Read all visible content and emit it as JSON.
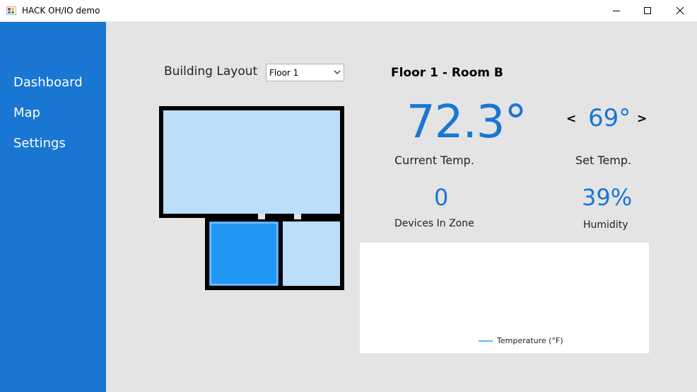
{
  "window": {
    "title": "HACK OH/IO demo",
    "controls": [
      "minimize",
      "maximize",
      "close"
    ]
  },
  "sidebar": {
    "background": "#1976d2",
    "items": [
      {
        "label": "Dashboard"
      },
      {
        "label": "Map"
      },
      {
        "label": "Settings"
      }
    ]
  },
  "layout": {
    "label": "Building Layout",
    "floor_select": {
      "value": "Floor 1"
    }
  },
  "room": {
    "title": "Floor 1 - Room B",
    "current_temp": "72.3°",
    "current_temp_label": "Current Temp.",
    "set_temp": "69°",
    "set_temp_label": "Set Temp.",
    "decrease": "<",
    "increase": ">",
    "devices": "0",
    "devices_label": "Devices In Zone",
    "humidity": "39%",
    "humidity_label": "Humidity"
  },
  "chart_data": {
    "type": "line",
    "series": [
      {
        "name": "Temperature (°F)",
        "values": []
      }
    ],
    "legend": "bottom-center"
  },
  "colors": {
    "accent": "#1976d2",
    "room_selected": "#2196f3",
    "room_default": "#bbdefb",
    "walls": "#000000"
  }
}
